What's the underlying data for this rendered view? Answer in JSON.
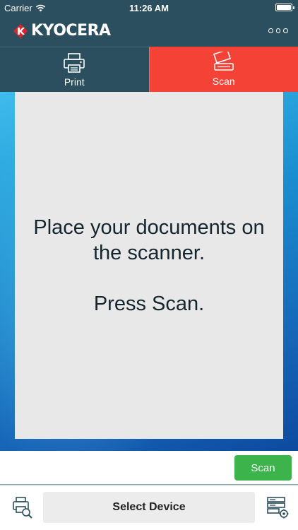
{
  "status_bar": {
    "carrier": "Carrier",
    "time": "11:26 AM",
    "wifi_icon": "wifi-icon",
    "battery_icon": "battery-icon"
  },
  "app_bar": {
    "logo_text": "KYOCERA",
    "logo_mark_icon": "kyocera-logo-mark",
    "more_icon": "more-horizontal-icon"
  },
  "tabs": [
    {
      "label": "Print",
      "icon": "printer-icon",
      "selected": false
    },
    {
      "label": "Scan",
      "icon": "scanner-icon",
      "selected": true
    }
  ],
  "main": {
    "instruction_line1": "Place your documents on the scanner.",
    "instruction_line2": "Press Scan."
  },
  "actions": {
    "scan_label": "Scan"
  },
  "bottom_bar": {
    "select_device_label": "Select Device",
    "left_icon": "device-search-icon",
    "right_icon": "server-settings-icon"
  },
  "colors": {
    "header_bg": "#2b4f5e",
    "scan_tab_bg": "#f44336",
    "scan_button_bg": "#3db34b",
    "panel_bg": "#e8e8e8",
    "logo_red": "#d9252c"
  }
}
